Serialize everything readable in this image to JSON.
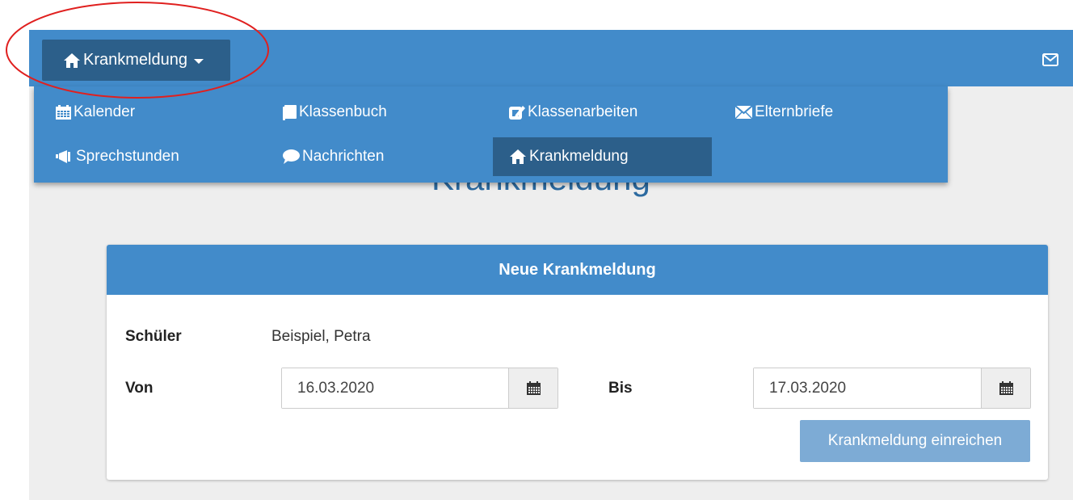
{
  "navbar": {
    "toggle_label": "Krankmeldung",
    "toggle_icon": "home-icon",
    "mail_icon": "envelope-icon",
    "brand_color": "#428bca",
    "active_color": "#2c5f8a"
  },
  "menu": {
    "items": [
      {
        "label": "Kalender",
        "icon": "calendar-icon"
      },
      {
        "label": "Klassenbuch",
        "icon": "book-icon"
      },
      {
        "label": "Klassenarbeiten",
        "icon": "edit-icon"
      },
      {
        "label": "Elternbriefe",
        "icon": "envelope-icon"
      },
      {
        "label": "Sprechstunden",
        "icon": "megaphone-icon"
      },
      {
        "label": "Nachrichten",
        "icon": "comment-icon"
      },
      {
        "label": "Krankmeldung",
        "icon": "home-icon",
        "active": true
      }
    ]
  },
  "page": {
    "title": "Krankmeldung"
  },
  "panel": {
    "heading": "Neue Krankmeldung",
    "student_label": "Schüler",
    "student_value": "Beispiel, Petra",
    "from_label": "Von",
    "from_value": "16.03.2020",
    "to_label": "Bis",
    "to_value": "17.03.2020",
    "submit_label": "Krankmeldung einreichen",
    "submit_color": "#7dabd5"
  },
  "annotation": {
    "highlight_color": "#e0201f"
  }
}
